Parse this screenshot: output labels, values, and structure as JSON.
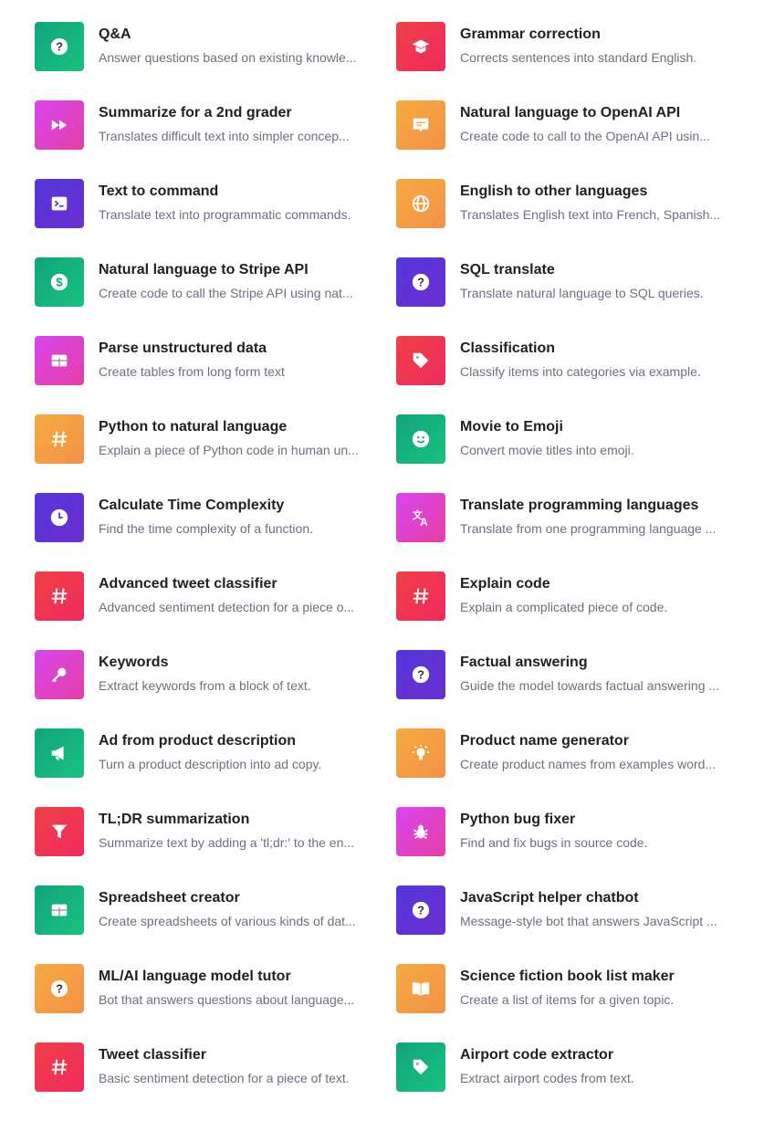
{
  "colors": {
    "green": "#10a37f",
    "magenta": "#d946ef",
    "purple": "#5436da",
    "orange": "#f4ab40",
    "red": "#ef4146"
  },
  "left": [
    {
      "title": "Q&A",
      "desc": "Answer questions based on existing knowle...",
      "icon": "question-icon",
      "color": "green"
    },
    {
      "title": "Summarize for a 2nd grader",
      "desc": "Translates difficult text into simpler concep...",
      "icon": "fast-forward-icon",
      "color": "magenta"
    },
    {
      "title": "Text to command",
      "desc": "Translate text into programmatic commands.",
      "icon": "terminal-icon",
      "color": "purple"
    },
    {
      "title": "Natural language to Stripe API",
      "desc": "Create code to call the Stripe API using nat...",
      "icon": "dollar-icon",
      "color": "green"
    },
    {
      "title": "Parse unstructured data",
      "desc": "Create tables from long form text",
      "icon": "table-icon",
      "color": "magenta"
    },
    {
      "title": "Python to natural language",
      "desc": "Explain a piece of Python code in human un...",
      "icon": "hash-icon",
      "color": "orange"
    },
    {
      "title": "Calculate Time Complexity",
      "desc": "Find the time complexity of a function.",
      "icon": "clock-icon",
      "color": "purple"
    },
    {
      "title": "Advanced tweet classifier",
      "desc": "Advanced sentiment detection for a piece o...",
      "icon": "hash-icon",
      "color": "red"
    },
    {
      "title": "Keywords",
      "desc": "Extract keywords from a block of text.",
      "icon": "key-icon",
      "color": "magenta"
    },
    {
      "title": "Ad from product description",
      "desc": "Turn a product description into ad copy.",
      "icon": "megaphone-icon",
      "color": "green"
    },
    {
      "title": "TL;DR summarization",
      "desc": "Summarize text by adding a 'tl;dr:' to the en...",
      "icon": "filter-icon",
      "color": "red"
    },
    {
      "title": "Spreadsheet creator",
      "desc": "Create spreadsheets of various kinds of dat...",
      "icon": "table-icon",
      "color": "green"
    },
    {
      "title": "ML/AI language model tutor",
      "desc": "Bot that answers questions about language...",
      "icon": "question-icon",
      "color": "orange"
    },
    {
      "title": "Tweet classifier",
      "desc": "Basic sentiment detection for a piece of text.",
      "icon": "hash-icon",
      "color": "red"
    }
  ],
  "right": [
    {
      "title": "Grammar correction",
      "desc": "Corrects sentences into standard English.",
      "icon": "graduation-cap-icon",
      "color": "red"
    },
    {
      "title": "Natural language to OpenAI API",
      "desc": "Create code to call to the OpenAI API usin...",
      "icon": "chat-icon",
      "color": "orange"
    },
    {
      "title": "English to other languages",
      "desc": "Translates English text into French, Spanish...",
      "icon": "globe-icon",
      "color": "orange"
    },
    {
      "title": "SQL translate",
      "desc": "Translate natural language to SQL queries.",
      "icon": "question-icon",
      "color": "purple"
    },
    {
      "title": "Classification",
      "desc": "Classify items into categories via example.",
      "icon": "tag-icon",
      "color": "red"
    },
    {
      "title": "Movie to Emoji",
      "desc": "Convert movie titles into emoji.",
      "icon": "smile-icon",
      "color": "green"
    },
    {
      "title": "Translate programming languages",
      "desc": "Translate from one programming language ...",
      "icon": "translate-icon",
      "color": "magenta"
    },
    {
      "title": "Explain code",
      "desc": "Explain a complicated piece of code.",
      "icon": "hash-icon",
      "color": "red"
    },
    {
      "title": "Factual answering",
      "desc": "Guide the model towards factual answering ...",
      "icon": "question-icon",
      "color": "purple"
    },
    {
      "title": "Product name generator",
      "desc": "Create product names from examples word...",
      "icon": "lightbulb-icon",
      "color": "orange"
    },
    {
      "title": "Python bug fixer",
      "desc": "Find and fix bugs in source code.",
      "icon": "bug-icon",
      "color": "magenta"
    },
    {
      "title": "JavaScript helper chatbot",
      "desc": "Message-style bot that answers JavaScript ...",
      "icon": "question-icon",
      "color": "purple"
    },
    {
      "title": "Science fiction book list maker",
      "desc": "Create a list of items for a given topic.",
      "icon": "book-icon",
      "color": "orange"
    },
    {
      "title": "Airport code extractor",
      "desc": "Extract airport codes from text.",
      "icon": "tag-icon",
      "color": "green"
    }
  ]
}
